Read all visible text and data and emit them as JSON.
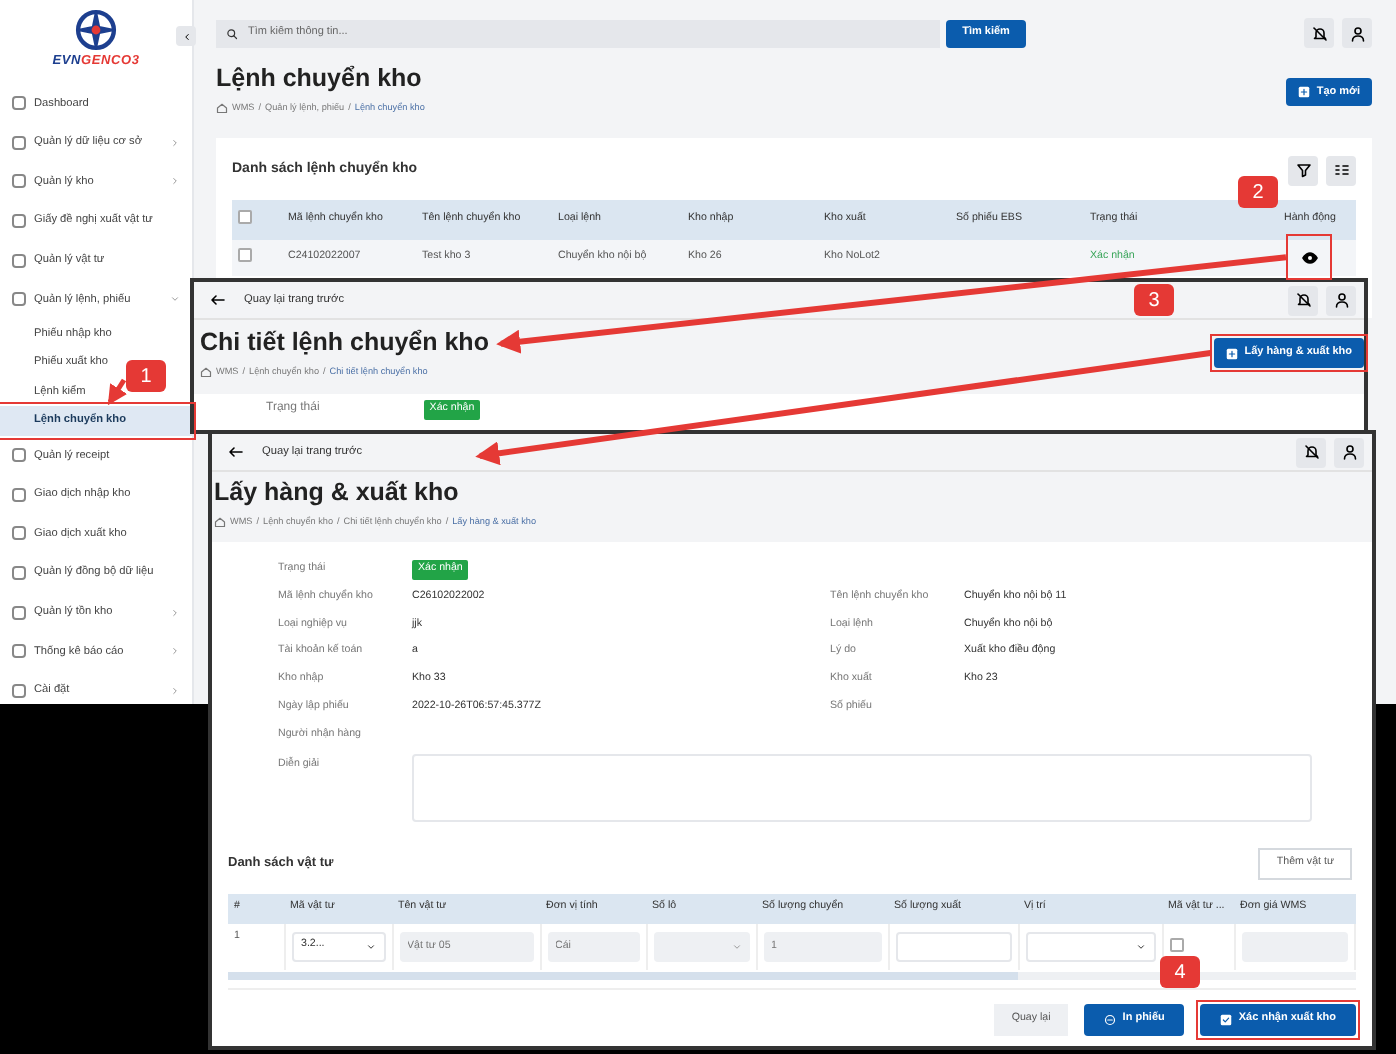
{
  "sidebar": {
    "logo": [
      "EVN",
      "GENCO3"
    ],
    "items": [
      {
        "label": "Dashboard",
        "kind": "link",
        "selected": false
      },
      {
        "label": "Quản lý dữ liệu cơ sở",
        "kind": "menu",
        "expanded": false,
        "selected": false
      },
      {
        "label": "Quản lý kho",
        "kind": "menu",
        "expanded": false,
        "selected": false
      },
      {
        "label": "Giấy đề nghị xuất vật tư",
        "kind": "link",
        "selected": false
      },
      {
        "label": "Quản lý vật tư",
        "kind": "link",
        "selected": false
      },
      {
        "label": "Quản lý lệnh, phiếu",
        "kind": "menu",
        "expanded": true,
        "selected": false
      },
      {
        "label": "Phiếu nhập kho",
        "kind": "sub",
        "selected": false
      },
      {
        "label": "Phiếu xuất kho",
        "kind": "sub",
        "selected": false
      },
      {
        "label": "Lệnh kiểm",
        "kind": "sub",
        "selected": false
      },
      {
        "label": "Lệnh chuyển kho",
        "kind": "sub",
        "selected": true
      },
      {
        "label": "Quản lý receipt",
        "kind": "link",
        "selected": false
      },
      {
        "label": "Giao dịch nhập kho",
        "kind": "link",
        "selected": false
      },
      {
        "label": "Giao dịch xuất kho",
        "kind": "link",
        "selected": false
      },
      {
        "label": "Quản lý đồng bộ dữ liệu",
        "kind": "link",
        "selected": false
      },
      {
        "label": "Quản lý tồn kho",
        "kind": "menu",
        "expanded": false,
        "selected": false
      },
      {
        "label": "Thống kê báo cáo",
        "kind": "menu",
        "expanded": false,
        "selected": false
      },
      {
        "label": "Cài đặt",
        "kind": "menu",
        "expanded": false,
        "selected": false
      }
    ]
  },
  "list_window": {
    "search": {
      "placeholder": "Tìm kiếm thông tin..."
    },
    "search_button": "Tìm kiếm",
    "title": "Lệnh chuyển kho",
    "breadcrumbs": [
      "WMS",
      "Quản lý lệnh, phiếu",
      "Lệnh chuyển kho"
    ],
    "breadcrumb_separator": "/",
    "create_button": "Tạo mới",
    "card_title": "Danh sách lệnh chuyển kho",
    "table": {
      "select_all_checked": false,
      "columns": [
        "Mã lệnh chuyển kho",
        "Tên lệnh chuyển kho",
        "Loại lệnh",
        "Kho nhập",
        "Kho xuất",
        "Số phiếu EBS",
        "Trạng thái",
        "Hành động"
      ],
      "rows": [
        {
          "checked": false,
          "cells": [
            "C24102022007",
            "Test kho 3",
            "Chuyển kho nội bộ",
            "Kho 26",
            "Kho NoLot2",
            "",
            "Xác nhận"
          ]
        }
      ]
    }
  },
  "detail_window": {
    "back_label": "Quay lại trang trước",
    "title": "Chi tiết lệnh chuyển kho",
    "breadcrumbs": [
      "WMS",
      "Lệnh chuyển kho",
      "Chi tiết lệnh chuyển kho"
    ],
    "breadcrumb_separator": "/",
    "action_button": "Lấy hàng & xuất kho",
    "status_label": "Trạng thái",
    "status": "Xác nhận"
  },
  "issue_window": {
    "back_label": "Quay lại trang trước",
    "title": "Lấy hàng & xuất kho",
    "breadcrumbs": [
      "WMS",
      "Lệnh chuyển kho",
      "Chi tiết lệnh chuyển kho",
      "Lấy hàng & xuất kho"
    ],
    "breadcrumb_separator": "/",
    "fields_left": [
      {
        "label": "Trạng thái",
        "value": "Xác nhận",
        "kind": "badge"
      },
      {
        "label": "Mã lệnh chuyển kho",
        "value": "C26102022002",
        "kind": "text"
      },
      {
        "label": "Loại nghiệp vụ",
        "value": "jjk",
        "kind": "text"
      },
      {
        "label": "Tài khoản kế toán",
        "value": "a",
        "kind": "text"
      },
      {
        "label": "Kho nhập",
        "value": "Kho 33",
        "kind": "text"
      },
      {
        "label": "Ngày lập phiếu",
        "value": "2022-10-26T06:57:45.377Z",
        "kind": "text"
      },
      {
        "label": "Người nhận hàng",
        "kind": "text"
      },
      {
        "label": "Diễn giải",
        "kind": "textarea"
      }
    ],
    "fields_right": [
      {
        "label": "Tên lệnh chuyển kho",
        "value": "Chuyển kho nội bộ 11"
      },
      {
        "label": "Loại lệnh",
        "value": "Chuyển kho nội bộ"
      },
      {
        "label": "Lý do",
        "value": "Xuất kho điều động"
      },
      {
        "label": "Kho xuất",
        "value": "Kho 23"
      },
      {
        "label": "Số phiếu"
      }
    ],
    "list_title": "Danh sách vật tư",
    "add_button": "Thêm vật tư",
    "table": {
      "columns": [
        "#",
        "Mã vật tư",
        "Tên vật tư",
        "Đơn vị tính",
        "Số lô",
        "Số lượng chuyển",
        "Số lượng xuất",
        "Vị trí",
        "Mã vật tư ...",
        "Đơn giá WMS"
      ],
      "rows": [
        {
          "cells": [
            {
              "kind": "text",
              "value": "1"
            },
            {
              "kind": "select",
              "value": "3.2...",
              "disabled": false
            },
            {
              "kind": "input",
              "placeholder": "Vật tư 05",
              "disabled": true
            },
            {
              "kind": "input",
              "placeholder": "Cái",
              "disabled": true
            },
            {
              "kind": "select",
              "disabled": true
            },
            {
              "kind": "input",
              "placeholder": "1",
              "disabled": true
            },
            {
              "kind": "input",
              "disabled": false
            },
            {
              "kind": "select",
              "disabled": false
            },
            {
              "kind": "checkbox",
              "checked": false
            },
            {
              "kind": "input",
              "disabled": true
            }
          ]
        }
      ]
    },
    "footer_buttons": [
      {
        "label": "Quay lại",
        "kind": "plain"
      },
      {
        "label": "In phiếu",
        "kind": "print"
      },
      {
        "label": "Xác nhận xuất kho",
        "kind": "confirm"
      }
    ]
  },
  "annotations": [
    {
      "label": "1"
    },
    {
      "label": "2"
    },
    {
      "label": "3"
    },
    {
      "label": "4"
    }
  ]
}
